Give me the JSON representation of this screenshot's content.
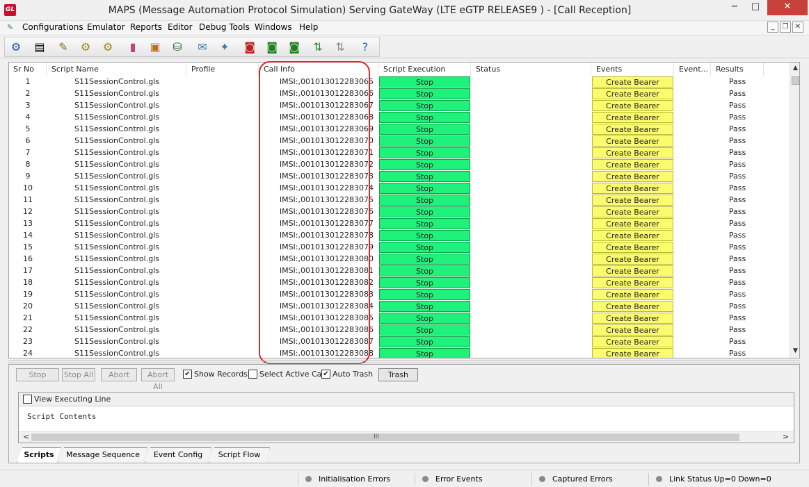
{
  "window": {
    "title": "MAPS (Message Automation Protocol Simulation) Serving GateWay (LTE eGTP RELEASE9 ) - [Call Reception]",
    "logo": "GL",
    "controls": {
      "minimize": "−",
      "maximize": "□",
      "close": "✕"
    }
  },
  "menubar": {
    "items": [
      "Configurations",
      "Emulator",
      "Reports",
      "Editor",
      "Debug Tools",
      "Windows",
      "Help"
    ],
    "mdi": {
      "minimize": "_",
      "restore": "❐",
      "close": "✕"
    }
  },
  "toolbar": {
    "icons": [
      "gear-icon",
      "notepad-icon",
      "script-edit-icon",
      "dll-icon",
      "multi-dll-icon",
      "profile-icon",
      "briefcase-icon",
      "database-lock-icon",
      "message-edit-icon",
      "network-icon",
      "doc-stop-icon",
      "doc-call-icon",
      "doc-profile-icon",
      "link-up-icon",
      "link-down-icon",
      "help-icon"
    ]
  },
  "grid": {
    "headers": [
      "Sr No",
      "Script Name",
      "Profile",
      "Call Info",
      "Script Execution",
      "Status",
      "Events",
      "Event...",
      "Results"
    ],
    "rows": [
      {
        "sr": "1",
        "script": "S11SessionControl.gls",
        "profile": "",
        "call": "IMSI:,001013012283065",
        "exec": "Stop",
        "status": "",
        "event": "Create Bearer",
        "event2": "",
        "result": "Pass"
      },
      {
        "sr": "2",
        "script": "S11SessionControl.gls",
        "profile": "",
        "call": "IMSI:,001013012283066",
        "exec": "Stop",
        "status": "",
        "event": "Create Bearer",
        "event2": "",
        "result": "Pass"
      },
      {
        "sr": "3",
        "script": "S11SessionControl.gls",
        "profile": "",
        "call": "IMSI:,001013012283067",
        "exec": "Stop",
        "status": "",
        "event": "Create Bearer",
        "event2": "",
        "result": "Pass"
      },
      {
        "sr": "4",
        "script": "S11SessionControl.gls",
        "profile": "",
        "call": "IMSI:,001013012283068",
        "exec": "Stop",
        "status": "",
        "event": "Create Bearer",
        "event2": "",
        "result": "Pass"
      },
      {
        "sr": "5",
        "script": "S11SessionControl.gls",
        "profile": "",
        "call": "IMSI:,001013012283069",
        "exec": "Stop",
        "status": "",
        "event": "Create Bearer",
        "event2": "",
        "result": "Pass"
      },
      {
        "sr": "6",
        "script": "S11SessionControl.gls",
        "profile": "",
        "call": "IMSI:,001013012283070",
        "exec": "Stop",
        "status": "",
        "event": "Create Bearer",
        "event2": "",
        "result": "Pass"
      },
      {
        "sr": "7",
        "script": "S11SessionControl.gls",
        "profile": "",
        "call": "IMSI:,001013012283071",
        "exec": "Stop",
        "status": "",
        "event": "Create Bearer",
        "event2": "",
        "result": "Pass"
      },
      {
        "sr": "8",
        "script": "S11SessionControl.gls",
        "profile": "",
        "call": "IMSI:,001013012283072",
        "exec": "Stop",
        "status": "",
        "event": "Create Bearer",
        "event2": "",
        "result": "Pass"
      },
      {
        "sr": "9",
        "script": "S11SessionControl.gls",
        "profile": "",
        "call": "IMSI:,001013012283073",
        "exec": "Stop",
        "status": "",
        "event": "Create Bearer",
        "event2": "",
        "result": "Pass"
      },
      {
        "sr": "10",
        "script": "S11SessionControl.gls",
        "profile": "",
        "call": "IMSI:,001013012283074",
        "exec": "Stop",
        "status": "",
        "event": "Create Bearer",
        "event2": "",
        "result": "Pass"
      },
      {
        "sr": "11",
        "script": "S11SessionControl.gls",
        "profile": "",
        "call": "IMSI:,001013012283075",
        "exec": "Stop",
        "status": "",
        "event": "Create Bearer",
        "event2": "",
        "result": "Pass"
      },
      {
        "sr": "12",
        "script": "S11SessionControl.gls",
        "profile": "",
        "call": "IMSI:,001013012283076",
        "exec": "Stop",
        "status": "",
        "event": "Create Bearer",
        "event2": "",
        "result": "Pass"
      },
      {
        "sr": "13",
        "script": "S11SessionControl.gls",
        "profile": "",
        "call": "IMSI:,001013012283077",
        "exec": "Stop",
        "status": "",
        "event": "Create Bearer",
        "event2": "",
        "result": "Pass"
      },
      {
        "sr": "14",
        "script": "S11SessionControl.gls",
        "profile": "",
        "call": "IMSI:,001013012283078",
        "exec": "Stop",
        "status": "",
        "event": "Create Bearer",
        "event2": "",
        "result": "Pass"
      },
      {
        "sr": "15",
        "script": "S11SessionControl.gls",
        "profile": "",
        "call": "IMSI:,001013012283079",
        "exec": "Stop",
        "status": "",
        "event": "Create Bearer",
        "event2": "",
        "result": "Pass"
      },
      {
        "sr": "16",
        "script": "S11SessionControl.gls",
        "profile": "",
        "call": "IMSI:,001013012283080",
        "exec": "Stop",
        "status": "",
        "event": "Create Bearer",
        "event2": "",
        "result": "Pass"
      },
      {
        "sr": "17",
        "script": "S11SessionControl.gls",
        "profile": "",
        "call": "IMSI:,001013012283081",
        "exec": "Stop",
        "status": "",
        "event": "Create Bearer",
        "event2": "",
        "result": "Pass"
      },
      {
        "sr": "18",
        "script": "S11SessionControl.gls",
        "profile": "",
        "call": "IMSI:,001013012283082",
        "exec": "Stop",
        "status": "",
        "event": "Create Bearer",
        "event2": "",
        "result": "Pass"
      },
      {
        "sr": "19",
        "script": "S11SessionControl.gls",
        "profile": "",
        "call": "IMSI:,001013012283083",
        "exec": "Stop",
        "status": "",
        "event": "Create Bearer",
        "event2": "",
        "result": "Pass"
      },
      {
        "sr": "20",
        "script": "S11SessionControl.gls",
        "profile": "",
        "call": "IMSI:,001013012283084",
        "exec": "Stop",
        "status": "",
        "event": "Create Bearer",
        "event2": "",
        "result": "Pass"
      },
      {
        "sr": "21",
        "script": "S11SessionControl.gls",
        "profile": "",
        "call": "IMSI:,001013012283085",
        "exec": "Stop",
        "status": "",
        "event": "Create Bearer",
        "event2": "",
        "result": "Pass"
      },
      {
        "sr": "22",
        "script": "S11SessionControl.gls",
        "profile": "",
        "call": "IMSI:,001013012283086",
        "exec": "Stop",
        "status": "",
        "event": "Create Bearer",
        "event2": "",
        "result": "Pass"
      },
      {
        "sr": "23",
        "script": "S11SessionControl.gls",
        "profile": "",
        "call": "IMSI:,001013012283087",
        "exec": "Stop",
        "status": "",
        "event": "Create Bearer",
        "event2": "",
        "result": "Pass"
      },
      {
        "sr": "24",
        "script": "S11SessionControl.gls",
        "profile": "",
        "call": "IMSI:,001013012283088",
        "exec": "Stop",
        "status": "",
        "event": "Create Bearer",
        "event2": "",
        "result": "Pass"
      }
    ],
    "scroll": {
      "up": "▲",
      "down": "▼"
    }
  },
  "controls": {
    "stop": "Stop",
    "stop_all": "Stop All",
    "abort": "Abort",
    "abort_all": "Abort All",
    "show_records": {
      "label": "Show Records",
      "checked": true
    },
    "select_active_call": {
      "label": "Select Active Call",
      "checked": false
    },
    "auto_trash": {
      "label": "Auto Trash",
      "checked": true
    },
    "trash": "Trash"
  },
  "script_panel": {
    "view_executing_line": {
      "label": "View Executing Line",
      "checked": false
    },
    "contents": "Script Contents",
    "grip": "III",
    "left": "<",
    "right": ">"
  },
  "tabs": [
    "Scripts",
    "Message Sequence",
    "Event Config",
    "Script Flow"
  ],
  "status": {
    "items": [
      "Initialisation Errors",
      "Error Events",
      "Captured Errors",
      "Link Status Up=0 Down=0"
    ]
  },
  "colors": {
    "exec_green": "#1ef27a",
    "events_yellow": "#fbfb6e",
    "highlight_red": "#d42a2a",
    "close_red": "#c7413a"
  }
}
